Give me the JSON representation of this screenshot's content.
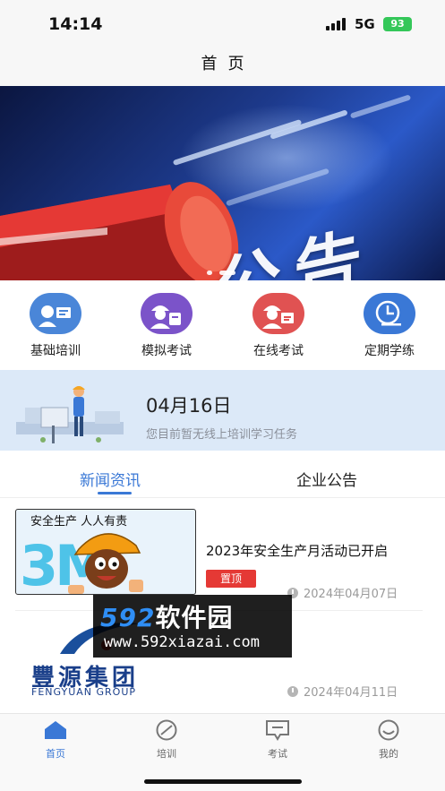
{
  "status_bar": {
    "time": "14:14",
    "network": "5G",
    "battery": "93"
  },
  "nav": {
    "title": "首页"
  },
  "banner": {
    "text": "公告"
  },
  "quick_actions": [
    {
      "label": "基础培训",
      "icon": "teacher-board-icon",
      "color": "#4a86d8"
    },
    {
      "label": "模拟考试",
      "icon": "worker-mock-exam-icon",
      "color": "#7b53c9"
    },
    {
      "label": "在线考试",
      "icon": "worker-online-exam-icon",
      "color": "#e05252"
    },
    {
      "label": "定期学练",
      "icon": "clock-icon",
      "color": "#3a78d6"
    }
  ],
  "task": {
    "date": "04月16日",
    "description": "您目前暂无线上培训学习任务"
  },
  "tabs": {
    "news": "新闻资讯",
    "notice": "企业公告"
  },
  "news": [
    {
      "title": "2023年安全生产月活动已开启",
      "badge": "置顶",
      "date": "2024年04月07日",
      "thumb_text": "安全生产  人人有责",
      "thumb_mark": "3M"
    },
    {
      "title": "",
      "date": "2024年04月11日",
      "thumb_cn": "豐源集团",
      "thumb_en": "FENGYUAN GROUP"
    }
  ],
  "watermark": {
    "logo_num": "592",
    "logo_cn": "软件园",
    "url": "www.592xiazai.com"
  },
  "tabbar": [
    {
      "label": "首页",
      "icon": "home-icon",
      "active": true
    },
    {
      "label": "培训",
      "icon": "compass-icon",
      "active": false
    },
    {
      "label": "考试",
      "icon": "message-exam-icon",
      "active": false
    },
    {
      "label": "我的",
      "icon": "smiley-profile-icon",
      "active": false
    }
  ],
  "colors": {
    "accent": "#3a78d6",
    "pin": "#e53935",
    "task_bg": "#dce9f8"
  }
}
